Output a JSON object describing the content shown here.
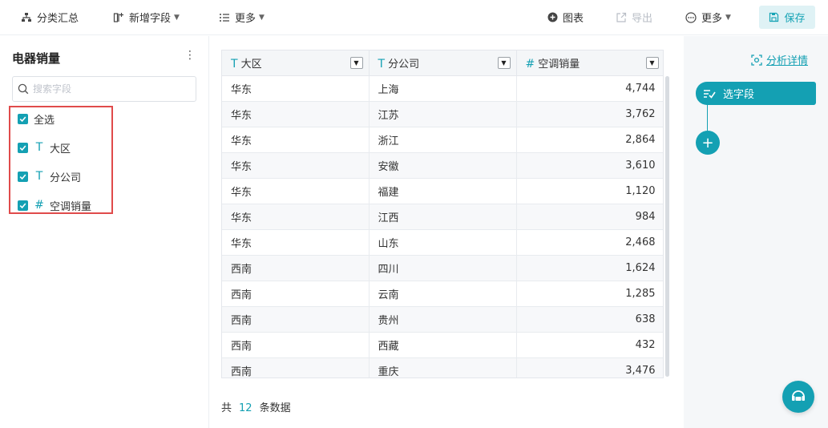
{
  "toolbar": {
    "group_summary": "分类汇总",
    "add_field": "新增字段",
    "more_left": "更多",
    "chart": "图表",
    "export": "导出",
    "more_right": "更多",
    "save": "保存"
  },
  "left_panel": {
    "title": "电器销量",
    "search_placeholder": "搜索字段",
    "fields": [
      {
        "label": "全选",
        "checked": true,
        "type": ""
      },
      {
        "label": "大区",
        "checked": true,
        "type": "text"
      },
      {
        "label": "分公司",
        "checked": true,
        "type": "text"
      },
      {
        "label": "空调销量",
        "checked": true,
        "type": "number"
      }
    ]
  },
  "table": {
    "columns": [
      {
        "label": "大区",
        "type": "text"
      },
      {
        "label": "分公司",
        "type": "text"
      },
      {
        "label": "空调销量",
        "type": "number"
      }
    ],
    "rows": [
      [
        "华东",
        "上海",
        "4,744"
      ],
      [
        "华东",
        "江苏",
        "3,762"
      ],
      [
        "华东",
        "浙江",
        "2,864"
      ],
      [
        "华东",
        "安徽",
        "3,610"
      ],
      [
        "华东",
        "福建",
        "1,120"
      ],
      [
        "华东",
        "江西",
        "984"
      ],
      [
        "华东",
        "山东",
        "2,468"
      ],
      [
        "西南",
        "四川",
        "1,624"
      ],
      [
        "西南",
        "云南",
        "1,285"
      ],
      [
        "西南",
        "贵州",
        "638"
      ],
      [
        "西南",
        "西藏",
        "432"
      ],
      [
        "西南",
        "重庆",
        "3,476"
      ]
    ]
  },
  "footer": {
    "prefix": "共",
    "count": "12",
    "suffix": "条数据"
  },
  "right_panel": {
    "detail_link": "分析详情",
    "step_label": "选字段"
  },
  "colors": {
    "accent": "#14a0b3",
    "highlight_border": "#e04b4b",
    "save_bg": "#dff2f5"
  }
}
